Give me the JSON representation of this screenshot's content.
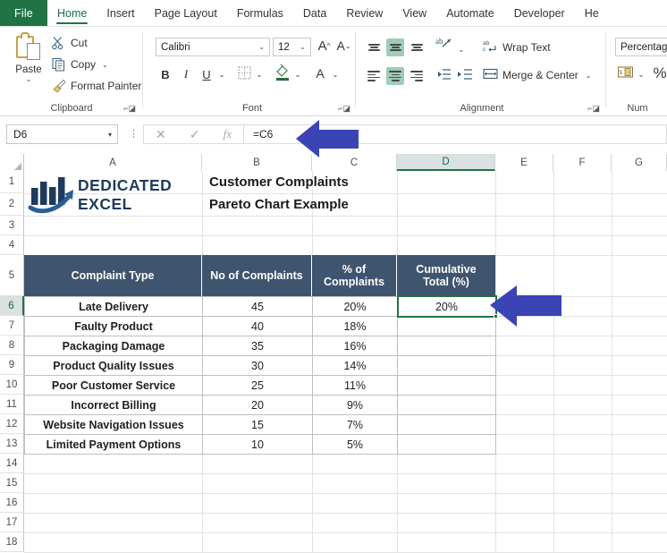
{
  "app": {
    "accent_green": "#217346",
    "header_fill": "#3f546e",
    "arrow_color": "#3b44b5"
  },
  "tabs": [
    {
      "label": "File",
      "active": false,
      "file": true
    },
    {
      "label": "Home",
      "active": true
    },
    {
      "label": "Insert",
      "active": false
    },
    {
      "label": "Page Layout",
      "active": false
    },
    {
      "label": "Formulas",
      "active": false
    },
    {
      "label": "Data",
      "active": false
    },
    {
      "label": "Review",
      "active": false
    },
    {
      "label": "View",
      "active": false
    },
    {
      "label": "Automate",
      "active": false
    },
    {
      "label": "Developer",
      "active": false
    },
    {
      "label": "He",
      "active": false
    }
  ],
  "ribbon": {
    "clipboard": {
      "group_label": "Clipboard",
      "paste_label": "Paste",
      "cut_label": "Cut",
      "copy_label": "Copy",
      "format_painter_label": "Format Painter",
      "icons": {
        "paste": "paste-icon",
        "cut": "scissors-icon",
        "copy": "copy-icon",
        "format_painter": "paintbrush-icon",
        "launcher": "dialog-launcher-icon"
      }
    },
    "font": {
      "group_label": "Font",
      "font_name": "Calibri",
      "font_size": "12",
      "grow_font": "A",
      "shrink_font": "A",
      "bold": "B",
      "italic": "I",
      "underline": "U",
      "borders_icon": "borders-icon",
      "fill_color_icon": "fill-color-icon",
      "font_color": "A",
      "launcher": "dialog-launcher-icon"
    },
    "alignment": {
      "group_label": "Alignment",
      "wrap_text_label": "Wrap Text",
      "merge_center_label": "Merge & Center",
      "orientation_icon": "orientation-icon",
      "decrease_indent_icon": "decrease-indent-icon",
      "increase_indent_icon": "increase-indent-icon",
      "launcher": "dialog-launcher-icon"
    },
    "number": {
      "group_label": "Num",
      "format_value": "Percentage",
      "accounting_icon": "accounting-format-icon",
      "percent_label": "%"
    }
  },
  "formula_bar": {
    "name_box": "D6",
    "cancel_icon": "close-icon",
    "enter_icon": "check-icon",
    "function_icon": "fx-icon",
    "formula": "=C6"
  },
  "grid": {
    "columns": [
      "A",
      "B",
      "C",
      "D",
      "E",
      "F",
      "G"
    ],
    "selected_column": "D",
    "selected_row": "6",
    "rows": [
      "1",
      "2",
      "3",
      "4",
      "5",
      "6",
      "7",
      "8",
      "9",
      "10",
      "11",
      "12",
      "13",
      "14",
      "15",
      "16",
      "17",
      "18"
    ],
    "logo": {
      "line1": "DEDICATED",
      "line2": "EXCEL",
      "name": "dedicated-excel-logo"
    },
    "title_line1": "Customer Complaints",
    "title_line2": "Pareto Chart Example",
    "table_headers": [
      "Complaint Type",
      "No of Complaints",
      "% of Complaints",
      "Cumulative Total (%)"
    ],
    "table_headers_wrapped": [
      [
        "Complaint Type"
      ],
      [
        "No of Complaints"
      ],
      [
        "% of",
        "Complaints"
      ],
      [
        "Cumulative",
        "Total (%)"
      ]
    ],
    "table_rows": [
      {
        "row": "6",
        "type": "Late Delivery",
        "count": "45",
        "percent": "20%",
        "cumulative": "20%"
      },
      {
        "row": "7",
        "type": "Faulty Product",
        "count": "40",
        "percent": "18%",
        "cumulative": ""
      },
      {
        "row": "8",
        "type": "Packaging Damage",
        "count": "35",
        "percent": "16%",
        "cumulative": ""
      },
      {
        "row": "9",
        "type": "Product Quality Issues",
        "count": "30",
        "percent": "14%",
        "cumulative": ""
      },
      {
        "row": "10",
        "type": "Poor Customer Service",
        "count": "25",
        "percent": "11%",
        "cumulative": ""
      },
      {
        "row": "11",
        "type": "Incorrect Billing",
        "count": "20",
        "percent": "9%",
        "cumulative": ""
      },
      {
        "row": "12",
        "type": "Website Navigation Issues",
        "count": "15",
        "percent": "7%",
        "cumulative": ""
      },
      {
        "row": "13",
        "type": "Limited Payment Options",
        "count": "10",
        "percent": "5%",
        "cumulative": ""
      }
    ]
  },
  "annotations": [
    {
      "name": "arrow-pointing-to-formula-bar",
      "direction": "left"
    },
    {
      "name": "arrow-pointing-to-selected-cell",
      "direction": "left"
    }
  ]
}
